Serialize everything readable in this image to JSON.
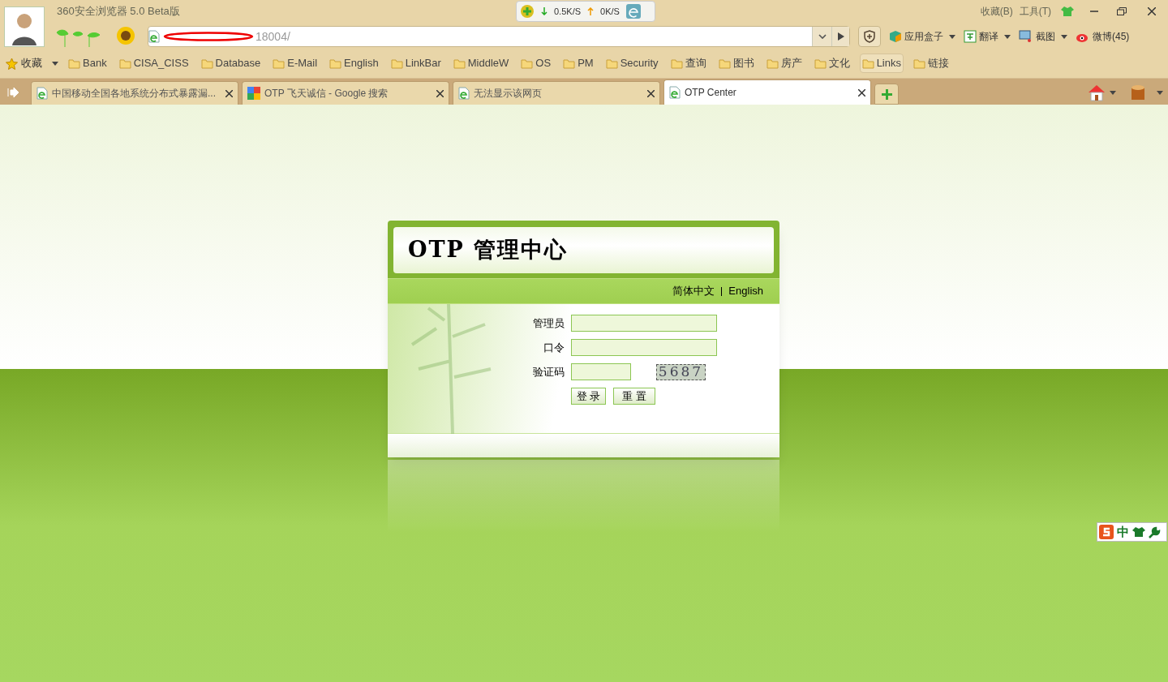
{
  "browser": {
    "title": "360安全浏览器 5.0 Beta版",
    "speed_down": "0.5K/S",
    "speed_up": "0K/S",
    "menus": [
      "收藏(B)",
      "工具(T)"
    ],
    "address": "18004/",
    "toolbar": [
      {
        "label": "应用盒子",
        "kind": "box"
      },
      {
        "label": "翻译",
        "kind": "translate"
      },
      {
        "label": "截图",
        "kind": "screenshot"
      },
      {
        "label": "微博(45)",
        "kind": "weibo"
      }
    ]
  },
  "bookmarks": {
    "label": "收藏",
    "items": [
      {
        "label": "Bank",
        "selected": false
      },
      {
        "label": "CISA_CISS",
        "selected": false
      },
      {
        "label": "Database",
        "selected": false
      },
      {
        "label": "E-Mail",
        "selected": false
      },
      {
        "label": "English",
        "selected": false
      },
      {
        "label": "LinkBar",
        "selected": false
      },
      {
        "label": "MiddleW",
        "selected": false
      },
      {
        "label": "OS",
        "selected": false
      },
      {
        "label": "PM",
        "selected": false
      },
      {
        "label": "Security",
        "selected": false
      },
      {
        "label": "查询",
        "selected": false
      },
      {
        "label": "图书",
        "selected": false
      },
      {
        "label": "房产",
        "selected": false
      },
      {
        "label": "文化",
        "selected": false
      },
      {
        "label": "Links",
        "selected": true
      },
      {
        "label": "链接",
        "selected": false
      }
    ]
  },
  "tabs": [
    {
      "label": "中国移动全国各地系统分布式暴露漏...",
      "kind": "ie",
      "selected": false
    },
    {
      "label": "OTP 飞天诚信 - Google 搜索",
      "kind": "google",
      "selected": false
    },
    {
      "label": "无法显示该网页",
      "kind": "ie",
      "selected": false
    },
    {
      "label": "OTP Center",
      "kind": "ie",
      "selected": true
    }
  ],
  "login": {
    "title": "OTP 管理中心",
    "languages": [
      "简体中文",
      "English"
    ],
    "fields": [
      {
        "label": "管理员",
        "kind": "wide"
      },
      {
        "label": "口令",
        "kind": "wide"
      },
      {
        "label": "验证码",
        "kind": "short"
      }
    ],
    "captcha": "5687",
    "buttons": [
      "登 录",
      "重 置"
    ]
  },
  "ime": {
    "label": "中"
  }
}
